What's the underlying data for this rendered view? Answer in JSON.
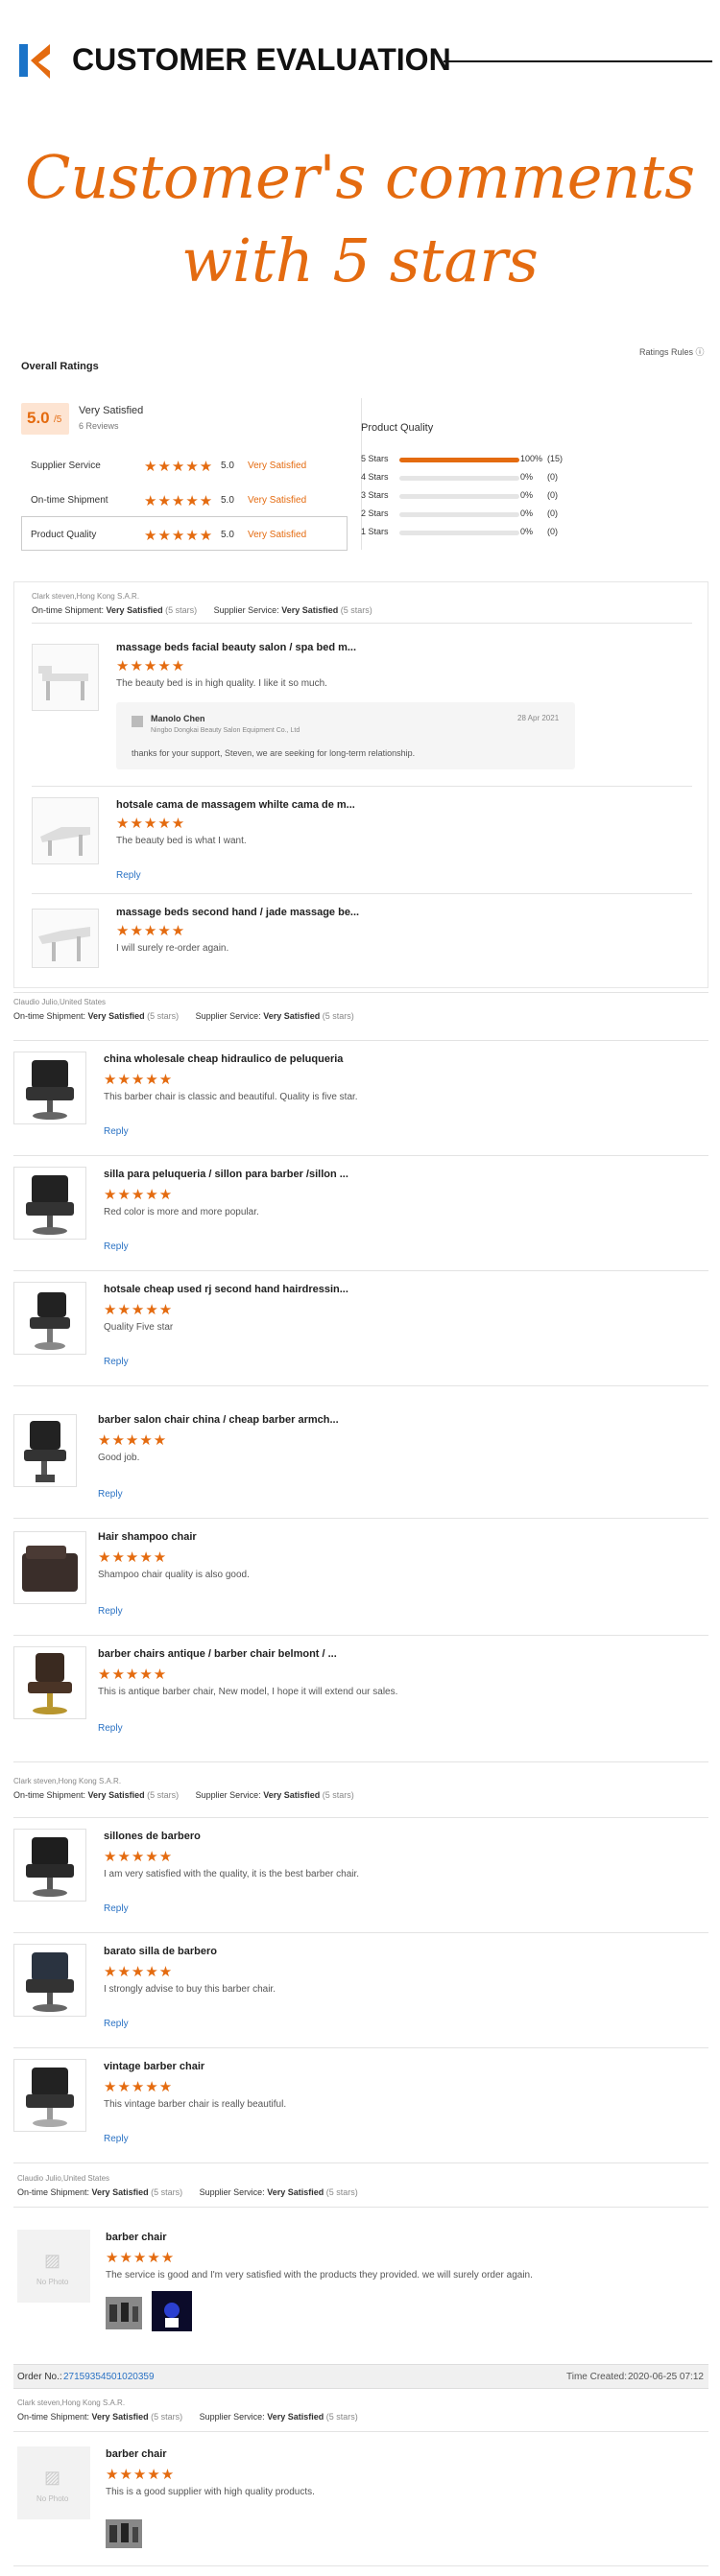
{
  "header": {
    "title": "CUSTOMER EVALUATION",
    "banner_line1": "Customer's comments",
    "banner_line2": "with 5 stars"
  },
  "summary": {
    "overall_label": "Overall Ratings",
    "rules_label": "Ratings Rules",
    "score": "5.0",
    "score_suffix": "/5",
    "satisfaction": "Very Satisfied",
    "reviews": "6 Reviews",
    "categories": [
      {
        "label": "Supplier Service",
        "stars": "★★★★★",
        "score": "5.0",
        "text": "Very Satisfied"
      },
      {
        "label": "On-time Shipment",
        "stars": "★★★★★",
        "score": "5.0",
        "text": "Very Satisfied"
      },
      {
        "label": "Product Quality",
        "stars": "★★★★★",
        "score": "5.0",
        "text": "Very Satisfied"
      }
    ],
    "quality_title": "Product Quality",
    "distribution": [
      {
        "label": "5 Stars",
        "fraction": 1.0,
        "pct": "100%",
        "count": "(15)"
      },
      {
        "label": "4 Stars",
        "fraction": 0,
        "pct": "0%",
        "count": "(0)"
      },
      {
        "label": "3 Stars",
        "fraction": 0,
        "pct": "0%",
        "count": "(0)"
      },
      {
        "label": "2 Stars",
        "fraction": 0,
        "pct": "0%",
        "count": "(0)"
      },
      {
        "label": "1 Stars",
        "fraction": 0,
        "pct": "0%",
        "count": "(0)"
      }
    ]
  },
  "labels": {
    "ontime": "On-time Shipment:",
    "supplier": "Supplier Service:",
    "very": "Very Satisfied",
    "fivestars": "(5 stars)",
    "reply": "Reply",
    "stars": "★★★★★",
    "nophoto": "No Photo"
  },
  "block1": {
    "user": "Clark steven,Hong Kong S.A.R.",
    "items": [
      {
        "title": "massage beds facial beauty salon / spa bed m...",
        "comment": "The beauty bed is in high quality. I like it so much."
      },
      {
        "title": "hotsale cama de massagem whilte cama de m...",
        "comment": "The beauty bed is what I want."
      },
      {
        "title": "massage beds second hand / jade massage be...",
        "comment": "I will surely re-order again."
      }
    ],
    "supplier_reply": {
      "name": "Manolo Chen",
      "date": "28 Apr 2021",
      "company": "Ningbo Dongkai Beauty Salon Equipment Co., Ltd",
      "text": "thanks for your support, Steven, we are seeking for long-term relationship."
    }
  },
  "block2": {
    "user": "Claudio Julio,United States",
    "items": [
      {
        "title": "china wholesale cheap hidraulico de peluqueria",
        "comment": "This barber chair is classic and beautiful. Quality is five star."
      },
      {
        "title": "silla para peluqueria / sillon para barber /sillon ...",
        "comment": "Red color is more and more popular."
      },
      {
        "title": "hotsale cheap used rj second hand hairdressin...",
        "comment": "Quality Five star"
      },
      {
        "title": "barber salon chair china / cheap barber armch...",
        "comment": "Good job."
      },
      {
        "title": "Hair shampoo chair",
        "comment": "Shampoo chair quality is also good."
      },
      {
        "title": "barber chairs antique / barber chair belmont / ...",
        "comment": "This is antique barber chair, New model, I hope it will extend our sales."
      }
    ]
  },
  "block3": {
    "user": "Clark steven,Hong Kong S.A.R.",
    "items": [
      {
        "title": "sillones de barbero",
        "comment": "I am very satisfied with the quality, it is the best barber chair."
      },
      {
        "title": "barato silla de barbero",
        "comment": "I strongly advise to buy this barber chair."
      },
      {
        "title": "vintage barber chair",
        "comment": "This vintage barber chair is really beautiful."
      }
    ]
  },
  "block4": {
    "user": "Claudio Julio,United States",
    "title": "barber chair",
    "comment": "The service is good and I'm very satisfied with the products they provided. we will surely order again."
  },
  "order": {
    "label": "Order No.:",
    "number": "27159354501020359",
    "time_label": "Time Created:",
    "time": "2020-06-25 07:12"
  },
  "block5": {
    "user": "Clark steven,Hong Kong S.A.R.",
    "title": "barber chair",
    "comment": "This is a good supplier with high quality products."
  },
  "colors": {
    "accent": "#e46b10",
    "link": "#2a72c4",
    "logo_blue": "#1a73c8"
  }
}
